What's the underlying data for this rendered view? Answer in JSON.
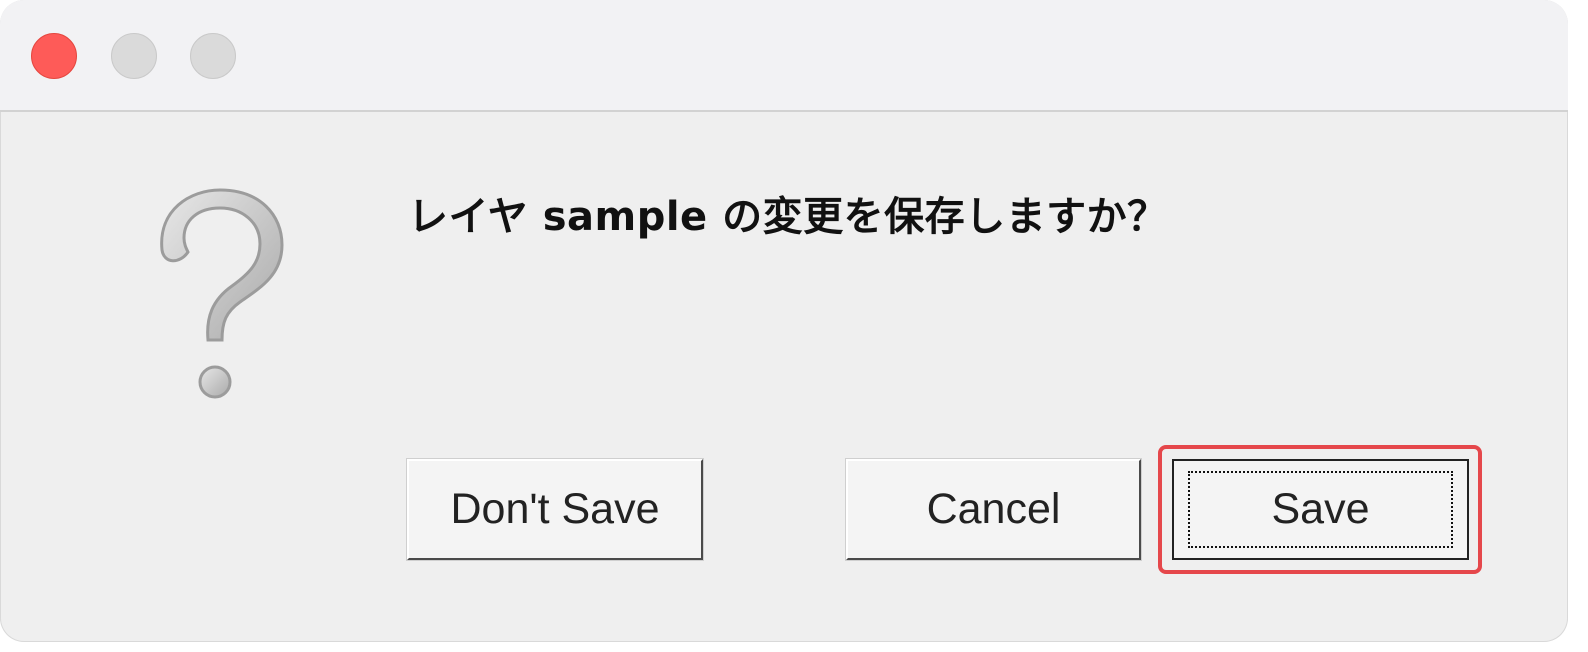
{
  "dialog": {
    "message": "レイヤ sample の変更を保存しますか？",
    "icon": "question-mark-icon"
  },
  "buttons": {
    "dont_save_label": "Don't Save",
    "cancel_label": "Cancel",
    "save_label": "Save"
  },
  "colors": {
    "close_button": "#fe5b58",
    "inactive_traffic": "#dadada",
    "highlight": "#e5474b",
    "window_bg": "#efefef"
  }
}
